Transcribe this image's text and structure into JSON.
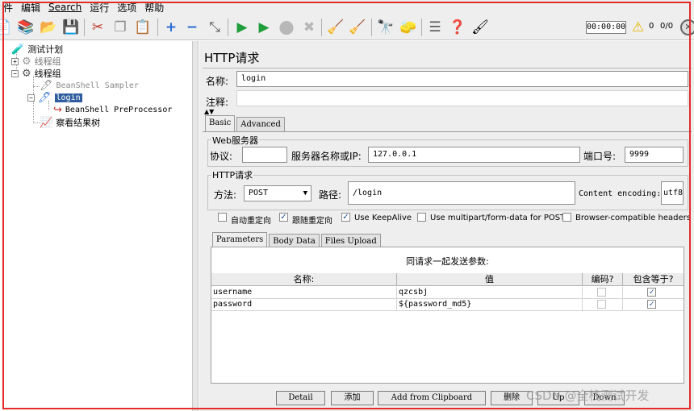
{
  "menu": [
    "件",
    "编辑",
    "Search",
    "运行",
    "选项",
    "帮助"
  ],
  "toolbar": {
    "timer": "00:00:00",
    "warn_count": "0",
    "thread_ratio": "0/0"
  },
  "tree": {
    "items": [
      {
        "label": "测试计划"
      },
      {
        "label": "线程组"
      },
      {
        "label": "线程组"
      },
      {
        "label": "BeanShell Sampler"
      },
      {
        "label": "login"
      },
      {
        "label": "BeanShell PreProcessor"
      },
      {
        "label": "察看结果树"
      }
    ]
  },
  "panel": {
    "title": "HTTP请求",
    "name_label": "名称:",
    "name_value": "login",
    "comment_label": "注释:",
    "tabs": [
      "Basic",
      "Advanced"
    ],
    "web_server": {
      "group_title": "Web服务器",
      "protocol_label": "协议:",
      "protocol_value": "",
      "server_label": "服务器名称或IP:",
      "server_value": "127.0.0.1",
      "port_label": "端口号:",
      "port_value": "9999"
    },
    "http_request": {
      "group_title": "HTTP请求",
      "method_label": "方法:",
      "method_value": "POST",
      "path_label": "路径:",
      "path_value": "/login",
      "encoding_label": "Content encoding:",
      "encoding_value": "utf8"
    },
    "checkboxes": [
      {
        "label": "自动重定向",
        "checked": false
      },
      {
        "label": "跟随重定向",
        "checked": true
      },
      {
        "label": "Use KeepAlive",
        "checked": true
      },
      {
        "label": "Use multipart/form-data for POST",
        "checked": false
      },
      {
        "label": "Browser-compatible headers",
        "checked": false
      }
    ],
    "subtabs": [
      "Parameters",
      "Body Data",
      "Files Upload"
    ],
    "params_caption": "同请求一起发送参数:",
    "columns": [
      "名称:",
      "值",
      "编码?",
      "包含等于?"
    ],
    "rows": [
      {
        "name": "username",
        "value": "qzcsbj",
        "encode": false,
        "include_equals": true
      },
      {
        "name": "password",
        "value": "${password_md5}",
        "encode": false,
        "include_equals": true
      }
    ],
    "buttons": [
      "Detail",
      "添加",
      "Add from Clipboard",
      "删除",
      "Up",
      "Down"
    ]
  },
  "watermark": "CSDN @全栈测试开发"
}
